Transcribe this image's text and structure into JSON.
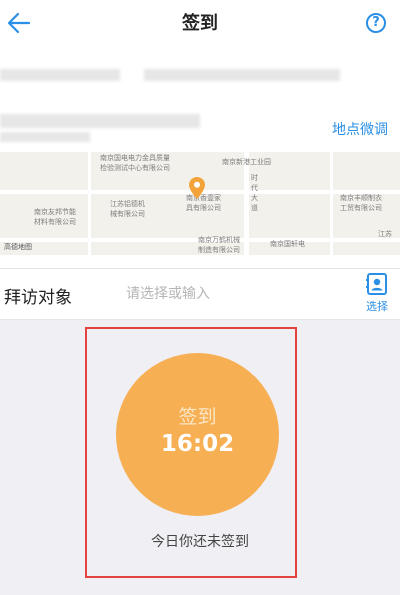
{
  "header": {
    "title": "签到",
    "help_glyph": "?"
  },
  "location": {
    "adjust_label": "地点微调"
  },
  "map": {
    "labels": [
      {
        "name": "map-poi-label-1",
        "text": "南京国电电力金具质量"
      },
      {
        "name": "map-poi-label-2",
        "text": "检验测试中心有限公司"
      },
      {
        "name": "map-poi-label-3",
        "text": "南京新港工业园"
      },
      {
        "name": "map-poi-label-4",
        "text": "江苏铝德机"
      },
      {
        "name": "map-poi-label-5",
        "text": "械有限公司"
      },
      {
        "name": "map-poi-label-6",
        "text": "南京友邦节能"
      },
      {
        "name": "map-poi-label-7",
        "text": "材料有限公司"
      },
      {
        "name": "map-poi-label-8",
        "text": "南京香壹家"
      },
      {
        "name": "map-poi-label-9",
        "text": "具有限公司"
      },
      {
        "name": "map-poi-label-10",
        "text": "时"
      },
      {
        "name": "map-poi-label-11",
        "text": "代"
      },
      {
        "name": "map-poi-label-12",
        "text": "大"
      },
      {
        "name": "map-poi-label-13",
        "text": "道"
      },
      {
        "name": "map-poi-label-14",
        "text": "南京丰顺制衣"
      },
      {
        "name": "map-poi-label-15",
        "text": "工贸有限公司"
      },
      {
        "name": "map-poi-label-16",
        "text": "南京万鹤机械"
      },
      {
        "name": "map-poi-label-17",
        "text": "制造有限公司"
      },
      {
        "name": "map-poi-label-18",
        "text": "南京国轩电"
      },
      {
        "name": "map-poi-label-19",
        "text": "江苏"
      }
    ],
    "logo_text": "高德地图"
  },
  "visit": {
    "label": "拜访对象",
    "placeholder": "请选择或输入",
    "choose_label": "选择"
  },
  "signin": {
    "label": "签到",
    "time": "16:02",
    "status": "今日你还未签到"
  },
  "colors": {
    "accent": "#2a8fe6",
    "signin_circle": "#f6af53",
    "highlight_border": "#e3423f",
    "bottom_background": "#efeff4"
  }
}
